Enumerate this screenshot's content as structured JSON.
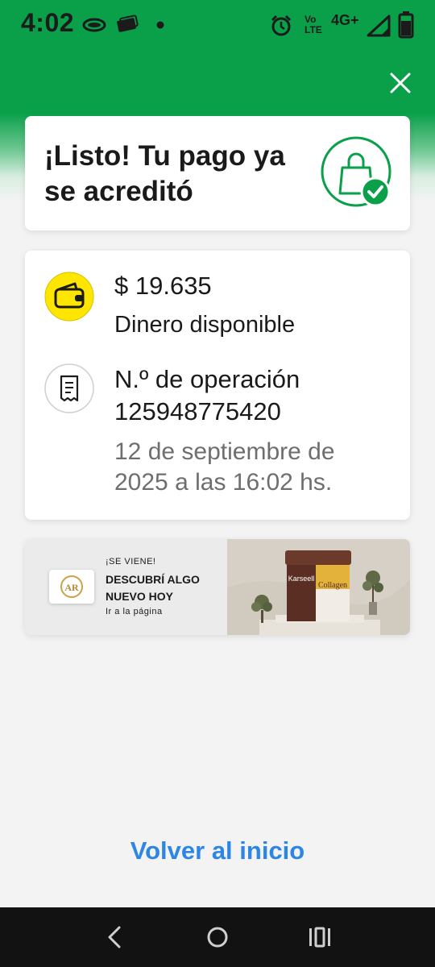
{
  "status_bar": {
    "time": "4:02",
    "network": "4G+",
    "volte_line1": "Vo",
    "volte_line2": "LTE"
  },
  "success": {
    "title": "¡Listo! Tu pago ya se acreditó"
  },
  "details": {
    "amount": "$ 19.635",
    "amount_label": "Dinero disponible",
    "operation_label": "N.º de operación",
    "operation_number": "125948775420",
    "date": "12 de septiembre de 2025 a las 16:02 hs."
  },
  "banner": {
    "kicker": "¡SE VIENE!",
    "headline": "DESCUBRÍ ALGO NUEVO HOY",
    "link": "Ir a la página",
    "logo_text": "AR",
    "product_brand": "Karseell",
    "product_name": "Collagen"
  },
  "footer": {
    "back_home": "Volver al inicio"
  },
  "colors": {
    "brand_green": "#0aa04a",
    "link_blue": "#2d86e6",
    "wallet_yellow": "#ffe600"
  },
  "icons": [
    "eye-icon",
    "money-icon",
    "alarm-icon",
    "signal-icon",
    "battery-icon",
    "close-icon",
    "shopping-bag-check-icon",
    "wallet-icon",
    "receipt-icon",
    "back-icon",
    "home-icon",
    "recents-icon"
  ]
}
